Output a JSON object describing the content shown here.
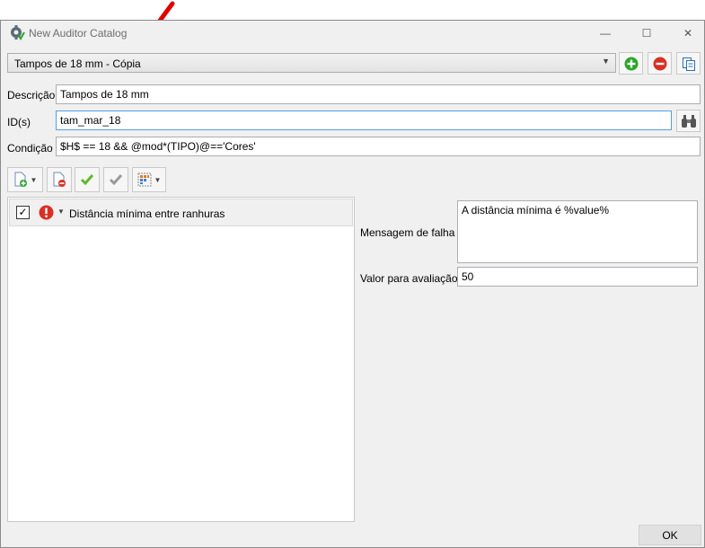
{
  "window": {
    "title": "New Auditor Catalog"
  },
  "controls": {
    "minimize": "—",
    "maximize": "☐",
    "close": "✕"
  },
  "catalog": {
    "selected": "Tampos de 18 mm - Cópia",
    "add_icon": "plus-circle-icon",
    "remove_icon": "minus-circle-icon",
    "duplicate_icon": "copy-icon"
  },
  "form": {
    "descricao_label": "Descrição",
    "descricao_value": "Tampos de 18 mm",
    "ids_label": "ID(s)",
    "ids_value": "tam_mar_18",
    "condicao_label": "Condição",
    "condicao_value": "$H$ == 18 && @mod*(TIPO)@=='Cores'"
  },
  "rules": [
    {
      "checked": true,
      "checkmark": "✓",
      "severity": "error",
      "label": "Distância mínima entre ranhuras"
    }
  ],
  "details": {
    "mensagem_label": "Mensagem de falha",
    "mensagem_value": "A distância mínima é %value%",
    "valor_label": "Valor para avaliação",
    "valor_value": "50"
  },
  "footer": {
    "ok_label": "OK"
  },
  "colors": {
    "accent_green": "#2aa52a",
    "accent_red": "#d93025",
    "focus_border": "#569de5",
    "annotation_arrow": "#e00000"
  }
}
